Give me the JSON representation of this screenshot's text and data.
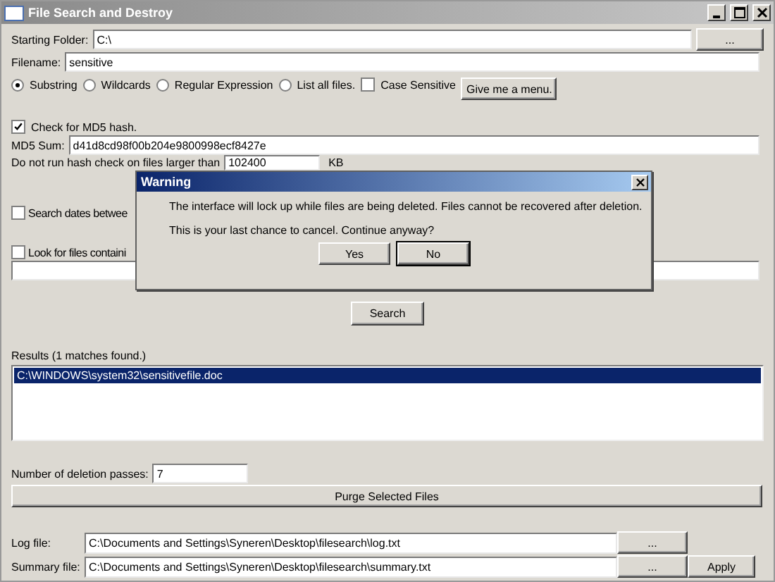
{
  "window": {
    "title": "File Search and Destroy"
  },
  "starting_folder": {
    "label": "Starting Folder:",
    "value": "C:\\",
    "browse": "..."
  },
  "filename": {
    "label": "Filename:",
    "value": "sensitive"
  },
  "match_modes": [
    {
      "label": "Substring",
      "selected": true
    },
    {
      "label": "Wildcards",
      "selected": false
    },
    {
      "label": "Regular Expression",
      "selected": false
    },
    {
      "label": "List all files.",
      "selected": false
    }
  ],
  "case_sensitive": {
    "label": "Case Sensitive",
    "checked": false
  },
  "menu_button": "Give me a menu.",
  "md5_check": {
    "label": "Check for MD5 hash.",
    "checked": true
  },
  "md5_sum": {
    "label": "MD5 Sum:",
    "value": "d41d8cd98f00b204e9800998ecf8427e"
  },
  "size_limit": {
    "label": "Do not run hash check on files larger than",
    "value": "102400",
    "unit": "KB"
  },
  "date_search": {
    "label": "Search dates betwee",
    "checked": false
  },
  "content_search": {
    "label": "Look for files containi",
    "checked": false
  },
  "search_button": "Search",
  "results": {
    "label": "Results (1 matches found.)",
    "items": [
      {
        "path": "C:\\WINDOWS\\system32\\sensitivefile.doc",
        "selected": true
      }
    ]
  },
  "passes": {
    "label": "Number of deletion passes:",
    "value": "7"
  },
  "purge_button": "Purge Selected Files",
  "log_file": {
    "label": "Log file:",
    "value": "C:\\Documents and Settings\\Syneren\\Desktop\\filesearch\\log.txt",
    "browse": "..."
  },
  "summary_file": {
    "label": "Summary file:",
    "value": "C:\\Documents and Settings\\Syneren\\Desktop\\filesearch\\summary.txt",
    "browse": "..."
  },
  "apply_button": "Apply",
  "dialog": {
    "title": "Warning",
    "message": "The interface will lock up while files are being deleted. Files cannot be recovered after deletion.",
    "question": "This is your last chance to cancel. Continue anyway?",
    "buttons": [
      {
        "label": "Yes",
        "selected": false
      },
      {
        "label": "No",
        "selected": true
      }
    ]
  }
}
